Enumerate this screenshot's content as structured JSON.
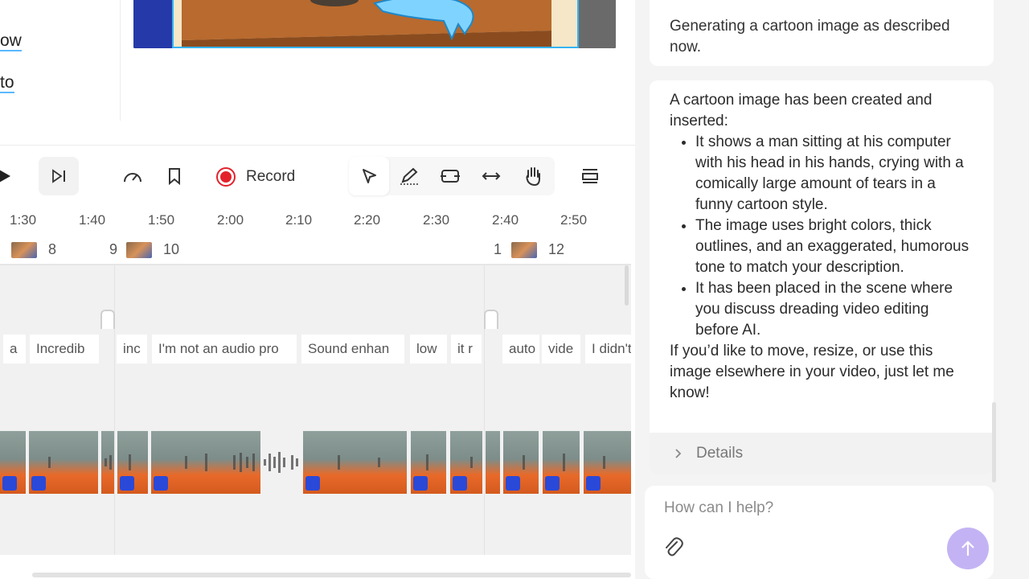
{
  "script": {
    "link1": "ow",
    "link2": "to"
  },
  "toolbar": {
    "record_label": "Record"
  },
  "timeline": {
    "ticks": [
      "1:30",
      "1:40",
      "1:50",
      "2:00",
      "2:10",
      "2:20",
      "2:30",
      "2:40",
      "2:50"
    ],
    "scenes": [
      {
        "num": "8"
      },
      {
        "num": "10"
      },
      {
        "num": "12"
      }
    ],
    "scene_partials": [
      "9",
      "1"
    ],
    "words": [
      "a",
      "Incredib",
      "inc",
      "I'm not an audio pro",
      "Sound enhan",
      "low",
      "it r",
      "auto",
      "vide",
      "I didn't"
    ]
  },
  "chat": {
    "msg1": "Generating a cartoon image as described now.",
    "msg2": {
      "intro": "A cartoon image has been created and inserted:",
      "bullets": [
        "It shows a man sitting at his computer with his head in his hands, crying with a comically large amount of tears in a funny cartoon style.",
        "The image uses bright colors, thick outlines, and an exaggerated, humorous tone to match your description.",
        "It has been placed in the scene where you discuss dreading video editing before AI."
      ],
      "outro": "If you’d like to move, resize, or use this image elsewhere in your video, just let me know!"
    },
    "details_label": "Details",
    "input_placeholder": "How can I help?"
  },
  "colors": {
    "record": "#e3212b",
    "send": "#c4b3f4",
    "selection": "#36b3f3"
  }
}
